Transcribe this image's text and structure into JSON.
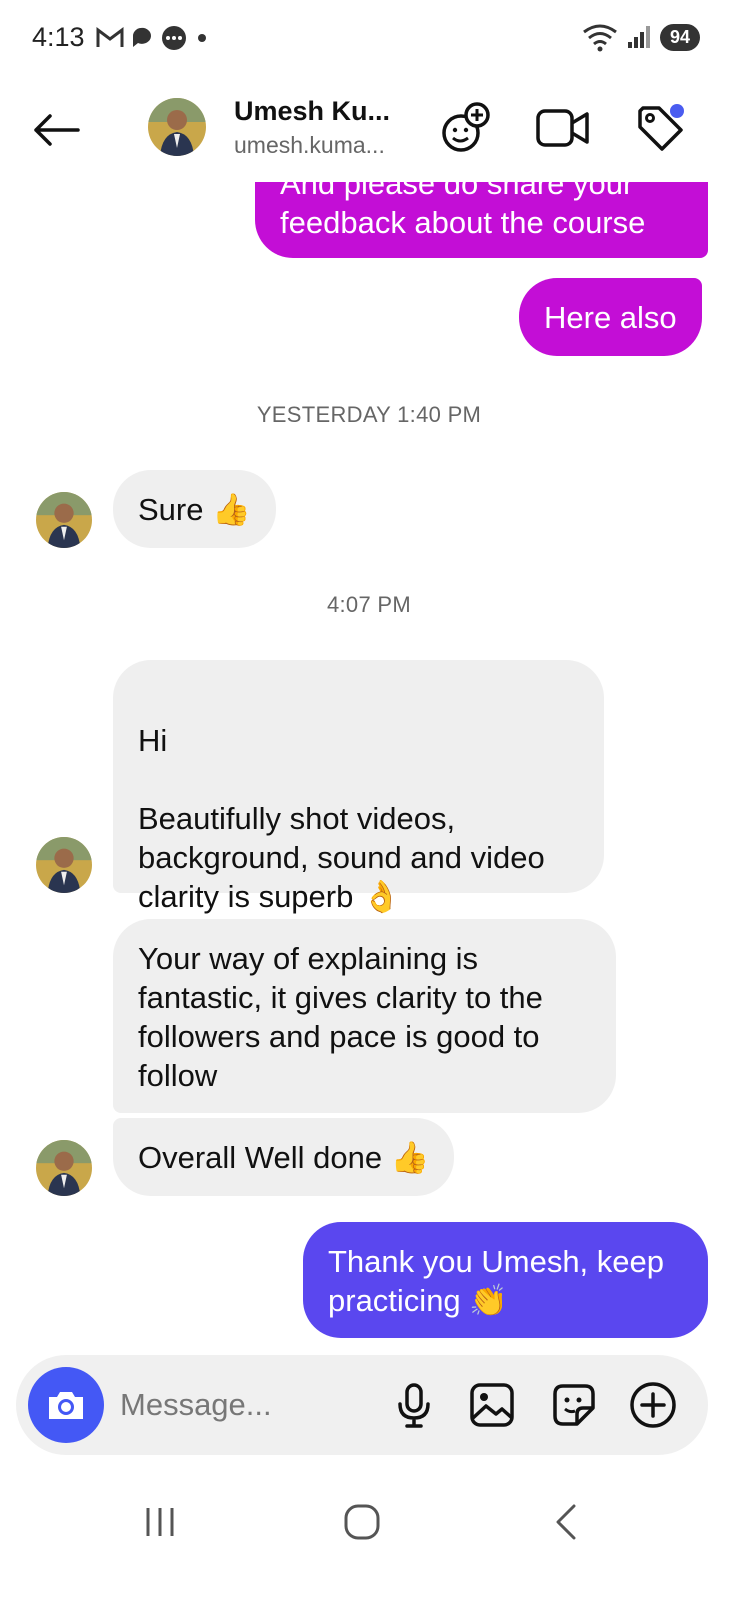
{
  "status_bar": {
    "time": "4:13",
    "battery": "94",
    "signal_badge": "6"
  },
  "header": {
    "contact_name": "Umesh Ku...",
    "contact_username": "umesh.kuma...",
    "icons": [
      "back-arrow-icon",
      "add-effect-icon",
      "video-call-icon",
      "tag-icon"
    ],
    "tag_dot_color": "#4a5cf0"
  },
  "messages": [
    {
      "from": "me",
      "text": "And please do share your feedback about the course",
      "color": "#c30ed6"
    },
    {
      "from": "me",
      "text": "Here also",
      "color": "#c30ed6"
    },
    {
      "type": "timestamp",
      "text": "YESTERDAY 1:40 PM"
    },
    {
      "from": "them",
      "text": "Sure 👍"
    },
    {
      "type": "timestamp",
      "text": "4:07 PM"
    },
    {
      "from": "them",
      "text": "Hi\n\nBeautifully shot videos, background, sound and video clarity is superb 👌"
    },
    {
      "from": "them",
      "text": "Your way of explaining is fantastic, it gives clarity to the followers and pace is good to follow"
    },
    {
      "from": "them",
      "text": "Overall Well done 👍"
    },
    {
      "from": "me",
      "text": "Thank you Umesh, keep practicing 👏",
      "color": "#5a47ef"
    }
  ],
  "composer": {
    "placeholder": "Message...",
    "icons": [
      "camera-icon",
      "microphone-icon",
      "gallery-icon",
      "sticker-icon",
      "plus-circle-icon"
    ],
    "camera_color": "#4458f5"
  },
  "navbar": {
    "icons": [
      "recents-icon",
      "home-icon",
      "back-icon"
    ]
  }
}
